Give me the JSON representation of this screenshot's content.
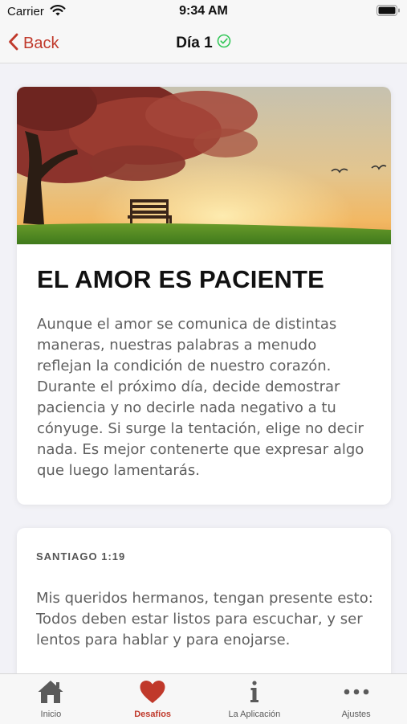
{
  "status_bar": {
    "carrier": "Carrier",
    "time": "9:34 AM"
  },
  "nav": {
    "back_label": "Back",
    "title": "Día 1"
  },
  "challenge": {
    "title": "EL AMOR ES PACIENTE",
    "body": "Aunque el amor se comunica de distintas maneras, nuestras palabras a menudo reflejan la condición de nuestro corazón. Durante el próximo día, decide demostrar paciencia y no decirle nada negativo a tu cónyuge. Si surge la tentación, elige no decir nada. Es mejor contenerte que expresar algo que luego lamentarás."
  },
  "verse": {
    "reference": "SANTIAGO 1:19",
    "text": "Mis queridos hermanos, tengan presente esto: Todos deben estar listos para escuchar, y ser lentos para hablar y para enojarse."
  },
  "tabs": [
    {
      "label": "Inicio",
      "icon": "home-icon"
    },
    {
      "label": "Desafíos",
      "icon": "heart-icon"
    },
    {
      "label": "La Aplicación",
      "icon": "info-icon"
    },
    {
      "label": "Ajustes",
      "icon": "more-icon"
    }
  ],
  "colors": {
    "accent": "#c0392b",
    "check": "#34c759"
  }
}
